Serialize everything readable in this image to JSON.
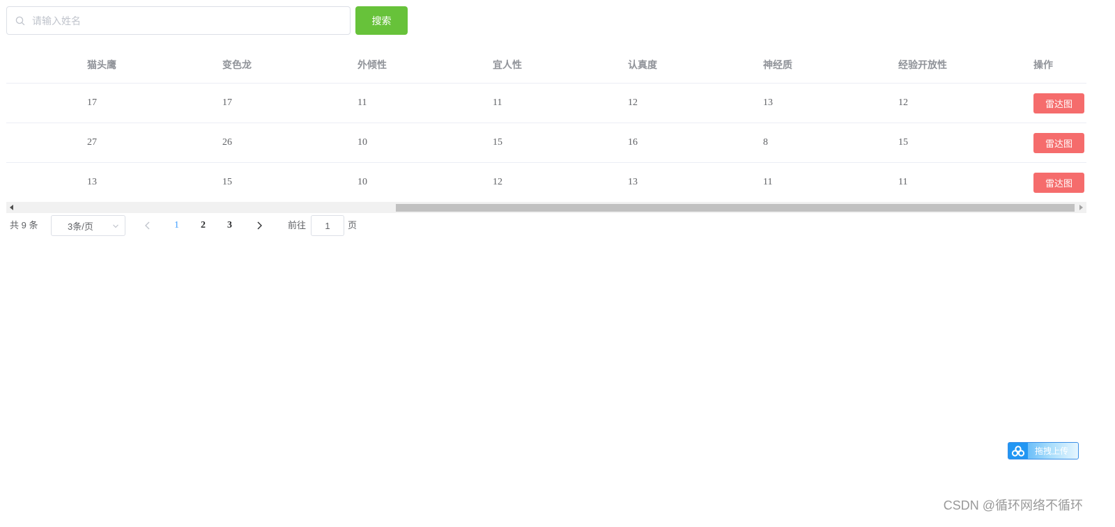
{
  "search": {
    "placeholder": "请输入姓名",
    "value": "",
    "button_label": "搜索"
  },
  "table": {
    "columns": [
      "猫头鹰",
      "变色龙",
      "外倾性",
      "宜人性",
      "认真度",
      "神经质",
      "经验开放性",
      "操作"
    ],
    "rows": [
      {
        "cells": [
          "17",
          "17",
          "11",
          "11",
          "12",
          "13",
          "12"
        ],
        "action_label": "雷达图"
      },
      {
        "cells": [
          "27",
          "26",
          "10",
          "15",
          "16",
          "8",
          "15"
        ],
        "action_label": "雷达图"
      },
      {
        "cells": [
          "13",
          "15",
          "10",
          "12",
          "13",
          "11",
          "11"
        ],
        "action_label": "雷达图"
      }
    ],
    "action_color": "#f56c6c"
  },
  "pagination": {
    "total_text": "共 9 条",
    "page_size": "3条/页",
    "pages": [
      "1",
      "2",
      "3"
    ],
    "current_page": "1",
    "goto_label": "前往",
    "goto_value": "1",
    "goto_suffix": "页"
  },
  "widget": {
    "label": "拖拽上传",
    "icon": "cloud-icon"
  },
  "watermark": "CSDN @循环网络不循环",
  "colors": {
    "primary": "#409eff",
    "success": "#67c23a",
    "danger": "#f56c6c"
  }
}
